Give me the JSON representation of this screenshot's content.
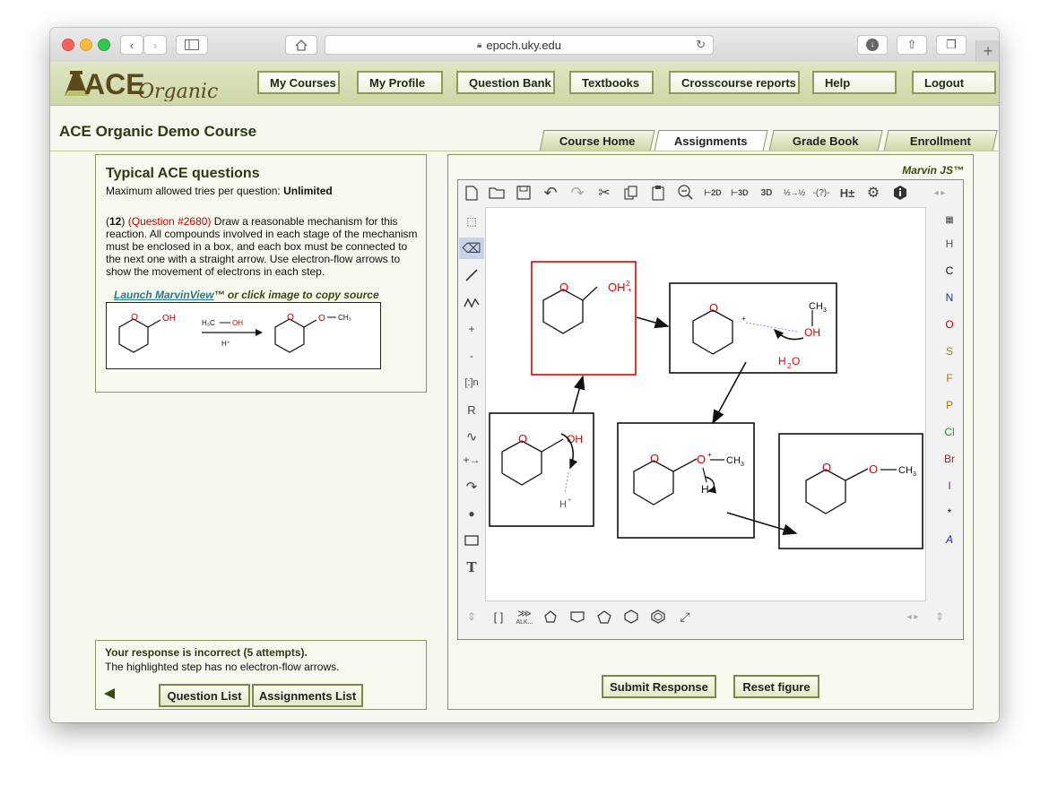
{
  "browser": {
    "url": "epoch.uky.edu"
  },
  "header": {
    "logo_text": "ACE",
    "logo_script": "Organic",
    "nav": [
      "My Courses",
      "My Profile",
      "Question Bank",
      "Textbooks",
      "Crosscourse reports",
      "Help",
      "Logout"
    ]
  },
  "course": {
    "title": "ACE Organic Demo Course"
  },
  "tabs": [
    "Course Home",
    "Assignments",
    "Grade Book",
    "Enrollment"
  ],
  "question": {
    "heading": "Typical ACE questions",
    "tries_label": "Maximum allowed tries per question: ",
    "tries_value": "Unlimited",
    "number": "12",
    "question_id": "(Question #2680)",
    "text": "Draw a reasonable mechanism for this reaction. All compounds involved in each stage of the mechanism must be enclosed in a box, and each box must be connected to the next one with a straight arrow. Use electron-flow arrows to show the movement of electrons in each step.",
    "launch_link": "Launch MarvinView",
    "launch_suffix": "™ or click image to copy source"
  },
  "feedback": {
    "status": "Your response is incorrect (5 attempts).",
    "detail": "The highlighted step has no electron-flow arrows.",
    "buttons": [
      "Question List",
      "Assignments List"
    ]
  },
  "marvin": {
    "label": "Marvin JS™",
    "elements": [
      "H",
      "C",
      "N",
      "O",
      "S",
      "F",
      "P",
      "Cl",
      "Br",
      "I",
      "*",
      "A"
    ],
    "element_colors": [
      "#555555",
      "#111111",
      "#2b2baa",
      "#d00000",
      "#8a8a00",
      "#b07010",
      "#b07010",
      "#1f8a1f",
      "#8a2a2a",
      "#7a1a8a",
      "#111111",
      "#2222aa"
    ],
    "bottom_label": "ALK..."
  },
  "actions": {
    "submit": "Submit Response",
    "reset": "Reset figure"
  }
}
